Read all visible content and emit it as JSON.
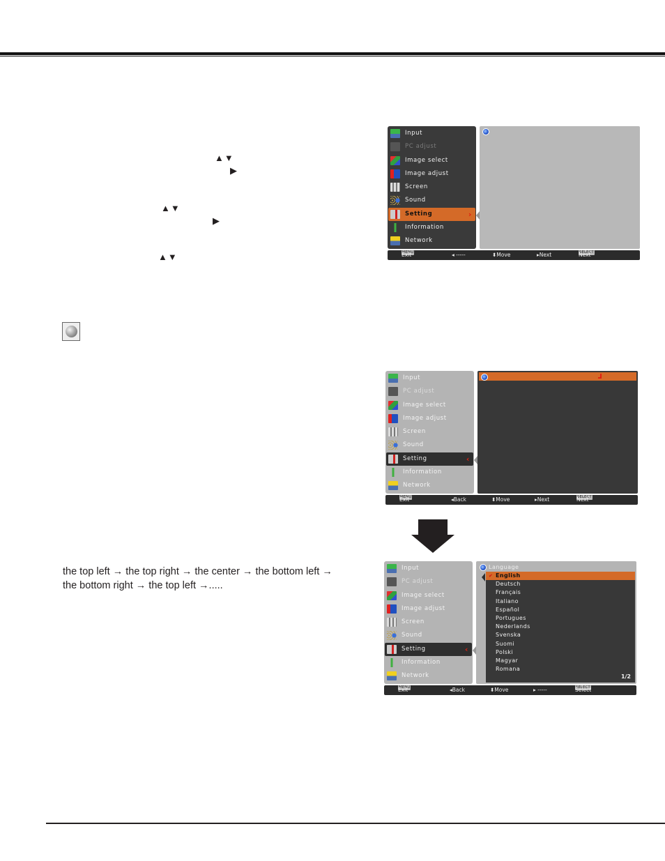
{
  "page": {
    "nav_glyphs": {
      "up_down": "▲▼",
      "right": "▶"
    },
    "language_icon": "globe-icon",
    "cycle_text_line1": "the top left → the top right  → the center  → the bottom left →",
    "cycle_text_line2": "the bottom right  → the top left  →....."
  },
  "menu_items": [
    {
      "label": "Input",
      "icon": "input-icon"
    },
    {
      "label": "PC adjust",
      "icon": "pc-adjust-icon"
    },
    {
      "label": "Image select",
      "icon": "image-select-icon"
    },
    {
      "label": "Image adjust",
      "icon": "image-adjust-icon"
    },
    {
      "label": "Screen",
      "icon": "screen-icon"
    },
    {
      "label": "Sound",
      "icon": "sound-icon"
    },
    {
      "label": "Setting",
      "icon": "setting-icon"
    },
    {
      "label": "Information",
      "icon": "information-icon"
    },
    {
      "label": "Network",
      "icon": "network-icon"
    }
  ],
  "osd1": {
    "selected": "Setting",
    "footer": {
      "exit_key": "MENU",
      "exit": "Exit",
      "back": "◂ -----",
      "move": "⬍Move",
      "next": "▸Next",
      "select_key": "SELECT",
      "select": "Next"
    }
  },
  "osd2": {
    "selected": "Setting",
    "footer": {
      "exit_key": "MENU",
      "exit": "Exit",
      "back": "◂Back",
      "move": "⬍Move",
      "next": "▸Next",
      "select_key": "SELECT",
      "select": "Next"
    }
  },
  "osd3": {
    "selected": "Setting",
    "submenu_title": "Language",
    "languages": [
      "English",
      "Deutsch",
      "Français",
      "Italiano",
      "Español",
      "Portugues",
      "Nederlands",
      "Svenska",
      "Suomi",
      "Polski",
      "Magyar",
      "Romana"
    ],
    "selected_language": "English",
    "check_mark": "✔",
    "page_indicator": "1/2",
    "footer": {
      "exit_key": "MENU",
      "exit": "Exit",
      "back": "◂Back",
      "move": "⬍Move",
      "next": "▸ -----",
      "select_key": "SELECT",
      "select": "Select"
    }
  },
  "colors": {
    "highlight_orange": "#d46a28",
    "osd_dark": "#383838",
    "osd_grey": "#b8b8b8",
    "chevron_red": "#e02010"
  }
}
